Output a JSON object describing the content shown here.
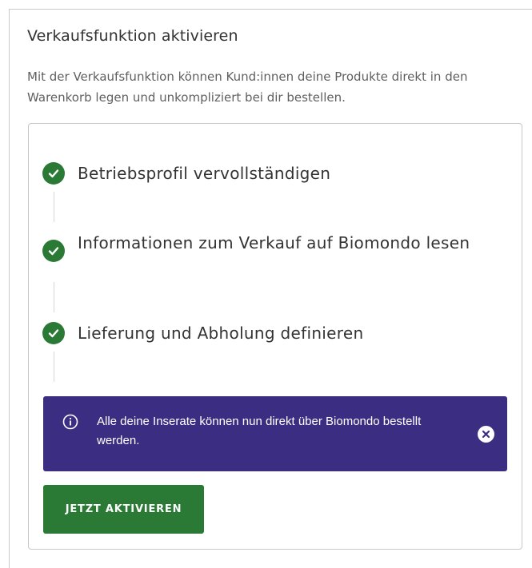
{
  "section": {
    "title": "Verkaufsfunktion aktivieren",
    "description": "Mit der Verkaufsfunktion können Kund:innen deine Produkte direkt in den Warenkorb legen und unkompliziert bei dir bestellen."
  },
  "steps": [
    {
      "label": "Betriebsprofil vervollständigen",
      "status": "completed",
      "icon": "check-circle-icon"
    },
    {
      "label": "Informationen zum Verkauf auf Biomondo lesen",
      "status": "completed",
      "icon": "check-circle-icon"
    },
    {
      "label": "Lieferung und Abholung definieren",
      "status": "completed",
      "icon": "check-circle-icon"
    }
  ],
  "banner": {
    "icon": "info-icon",
    "text": "Alle deine Inserate können nun direkt über Biomondo bestellt werden.",
    "close_icon": "close-icon"
  },
  "action": {
    "label": "JETZT AKTIVIEREN"
  },
  "colors": {
    "primary_green": "#2a7a36",
    "banner_purple": "#3b2e82",
    "title_text": "#333333",
    "body_text": "#5f5f5f",
    "border": "#c7c7c7"
  }
}
